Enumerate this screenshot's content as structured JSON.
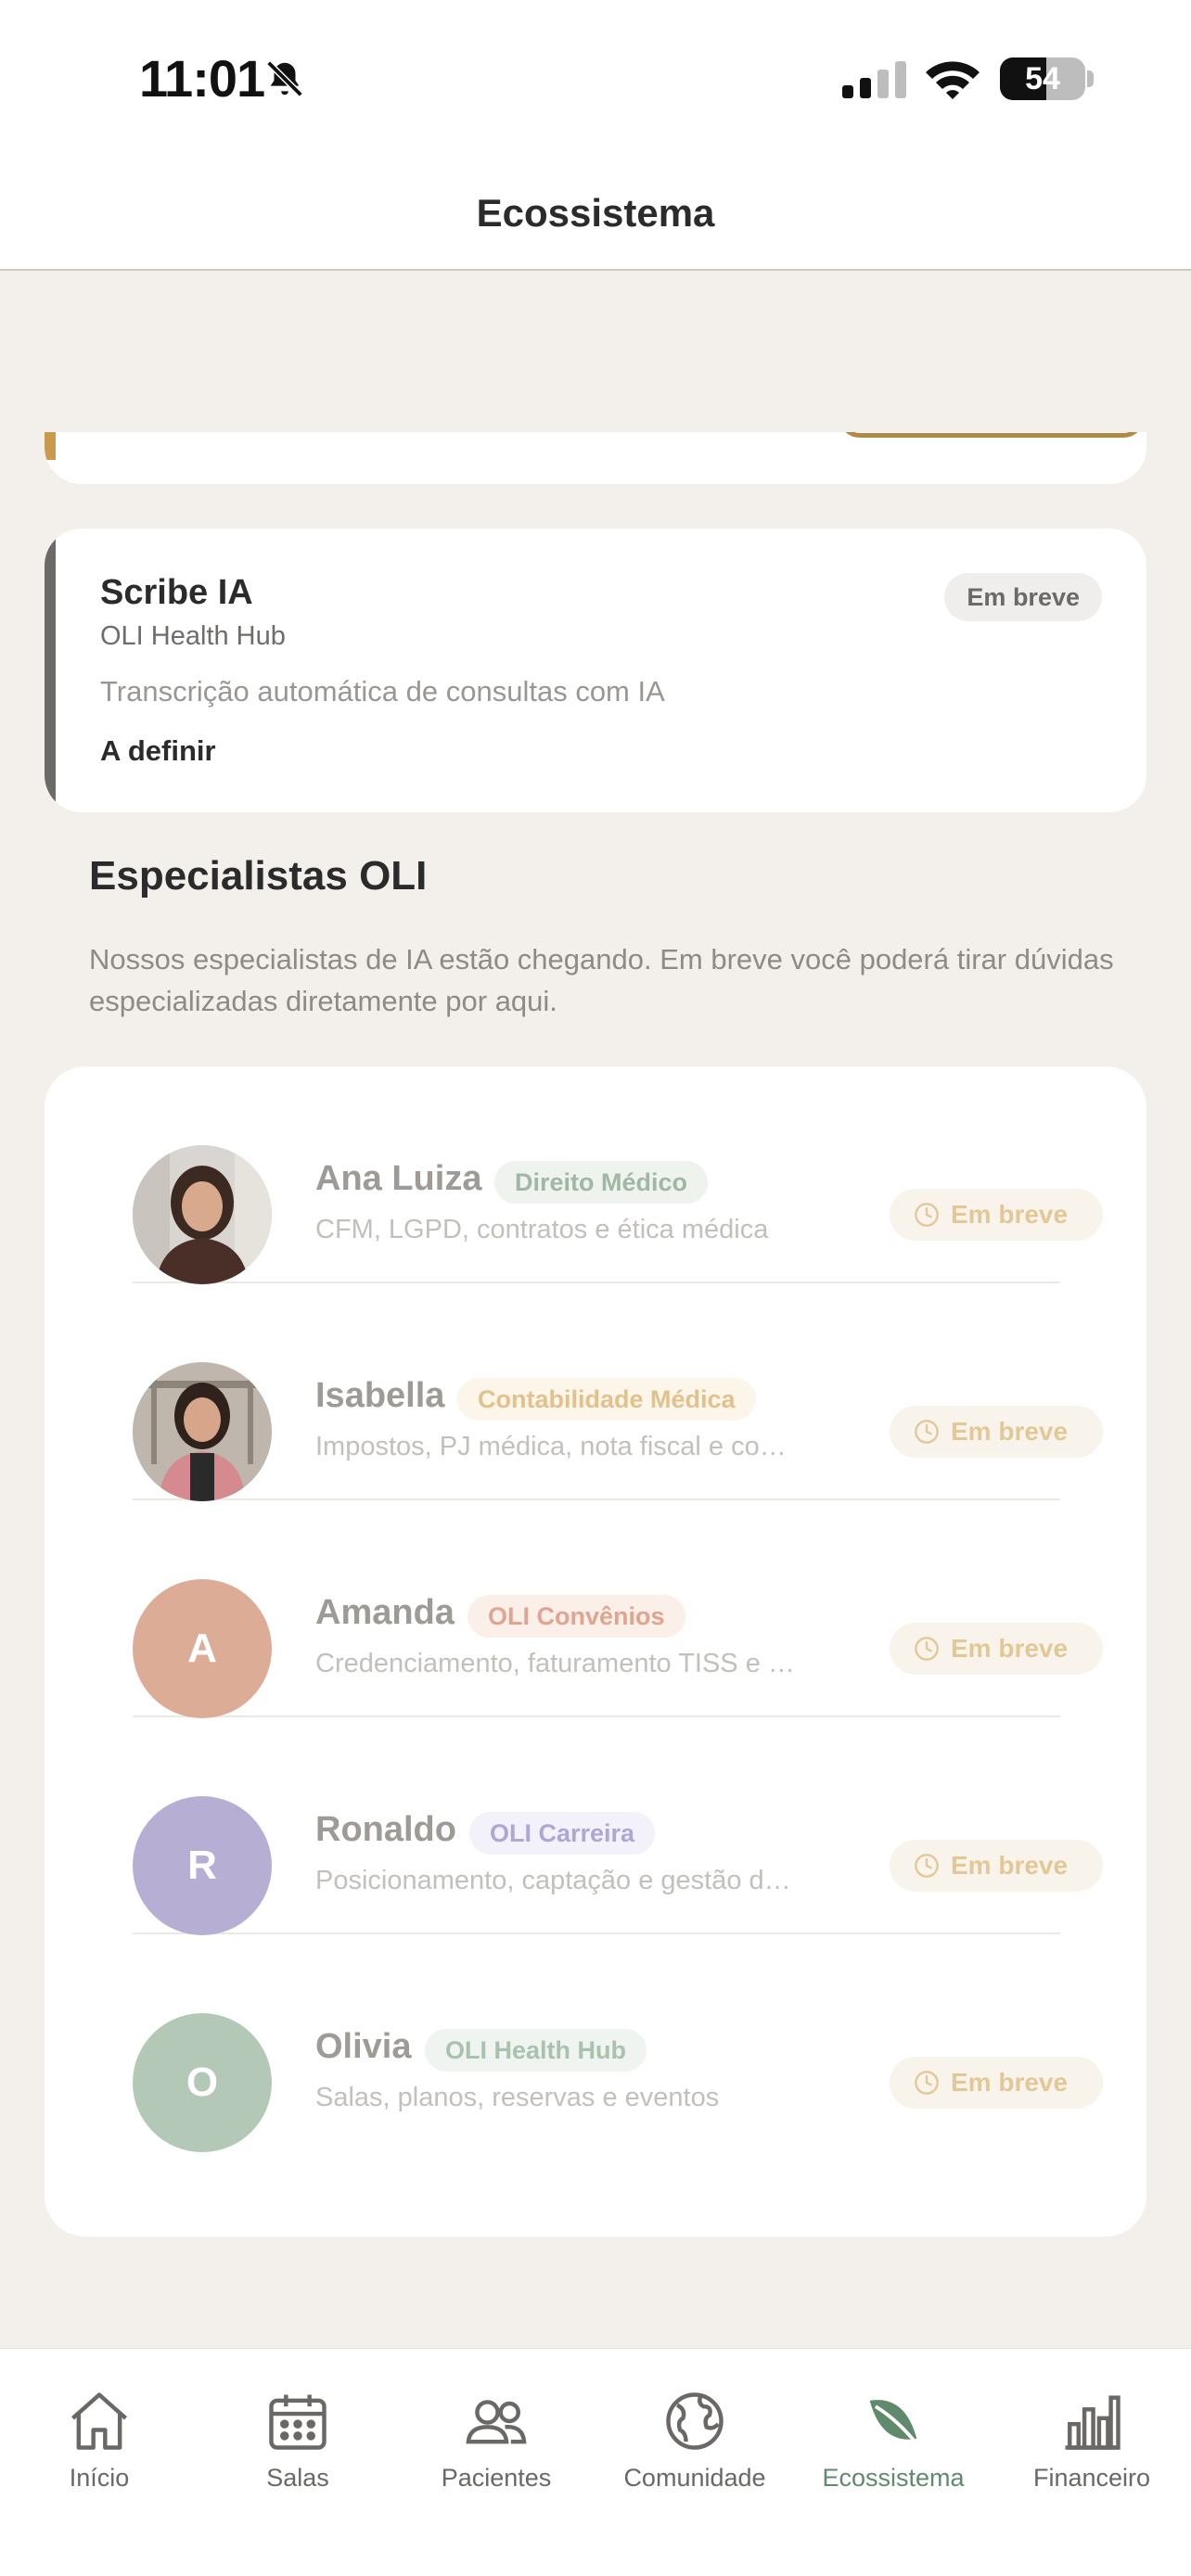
{
  "status_bar": {
    "time": "11:01",
    "battery": "54",
    "battery_level": 0.54
  },
  "header": {
    "title": "Ecossistema"
  },
  "product_card": {
    "title": "Scribe IA",
    "subtitle": "OLI Health Hub",
    "description": "Transcrição automática de consultas com IA",
    "price": "A definir",
    "badge": "Em breve"
  },
  "specialists": {
    "title": "Especialistas OLI",
    "description": "Nossos especialistas de IA estão chegando. Em breve você poderá tirar dúvidas especializadas diretamente por aqui.",
    "items": [
      {
        "name": "Ana Luiza",
        "tag": "Direito Médico",
        "description": "CFM, LGPD, contratos e ética médica",
        "status": "Em breve",
        "initial": "",
        "tag_color": "#9fb7a3",
        "tag_bg": "#eef3ee"
      },
      {
        "name": "Isabella",
        "tag": "Contabilidade Médica",
        "description": "Impostos, PJ médica, nota fiscal e contabilidade",
        "status": "Em breve",
        "initial": "",
        "tag_color": "#e2c28c",
        "tag_bg": "#fbf5ea"
      },
      {
        "name": "Amanda",
        "tag": "OLI Convênios",
        "description": "Credenciamento, faturamento TISS e glosas",
        "status": "Em breve",
        "initial": "A",
        "tag_color": "#e0a58f",
        "tag_bg": "#fbefea",
        "avatar_color": "#dcac96"
      },
      {
        "name": "Ronaldo",
        "tag": "OLI Carreira",
        "description": "Posicionamento, captação e gestão de carreira",
        "status": "Em breve",
        "initial": "R",
        "tag_color": "#b0a6d4",
        "tag_bg": "#f3f1fa",
        "avatar_color": "#b6aed3"
      },
      {
        "name": "Olivia",
        "tag": "OLI Health Hub",
        "description": "Salas, planos, reservas e eventos",
        "status": "Em breve",
        "initial": "O",
        "tag_color": "#a9c2ad",
        "tag_bg": "#f0f4f0",
        "avatar_color": "#b3c8b6"
      }
    ]
  },
  "tab_bar": {
    "items": [
      {
        "label": "Início",
        "icon": "home-icon"
      },
      {
        "label": "Salas",
        "icon": "calendar-icon"
      },
      {
        "label": "Pacientes",
        "icon": "users-icon"
      },
      {
        "label": "Comunidade",
        "icon": "globe-icon"
      },
      {
        "label": "Ecossistema",
        "icon": "leaf-icon",
        "active": true
      },
      {
        "label": "Financeiro",
        "icon": "bar-chart-icon"
      }
    ],
    "active_color": "#5f8a6b"
  }
}
